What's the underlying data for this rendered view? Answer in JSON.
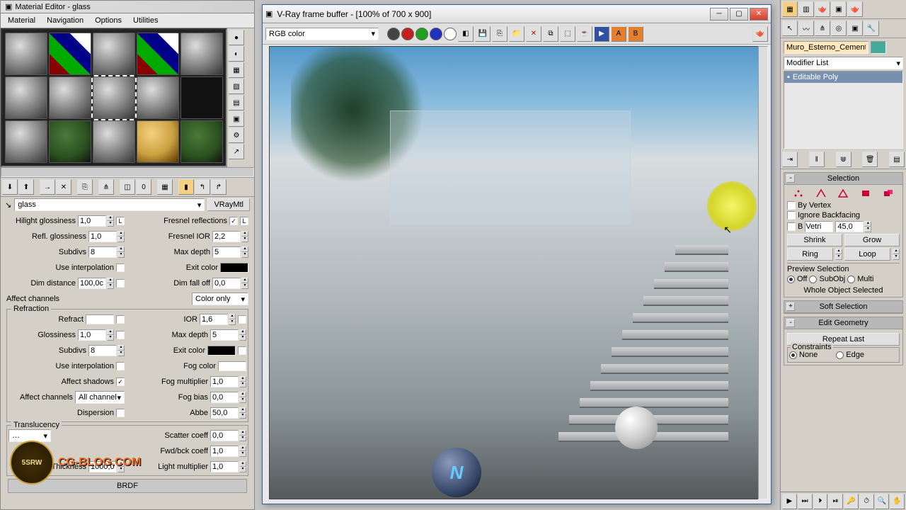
{
  "matEditor": {
    "title": "Material Editor - glass",
    "menu": [
      "Material",
      "Navigation",
      "Options",
      "Utilities"
    ],
    "nameDropdown": "glass",
    "matType": "VRayMtl",
    "hilightGloss": {
      "label": "Hilight glossiness",
      "val": "1,0"
    },
    "fresnelRefl": {
      "label": "Fresnel reflections",
      "checked": true
    },
    "reflGloss": {
      "label": "Refl. glossiness",
      "val": "1,0"
    },
    "fresnelIOR": {
      "label": "Fresnel IOR",
      "val": "2,2"
    },
    "subdivs": {
      "label": "Subdivs",
      "val": "8"
    },
    "maxDepth": {
      "label": "Max depth",
      "val": "5"
    },
    "useInterp": {
      "label": "Use interpolation"
    },
    "exitColor": {
      "label": "Exit color"
    },
    "dimDist": {
      "label": "Dim distance",
      "val": "100,0c"
    },
    "dimFalloff": {
      "label": "Dim fall off",
      "val": "0,0"
    },
    "affectCh": {
      "label": "Affect channels",
      "val": "Color only"
    },
    "refraction": {
      "title": "Refraction",
      "refract": {
        "label": "Refract"
      },
      "ior": {
        "label": "IOR",
        "val": "1,6"
      },
      "gloss": {
        "label": "Glossiness",
        "val": "1,0"
      },
      "maxDepth": {
        "label": "Max depth",
        "val": "5"
      },
      "subdivs": {
        "label": "Subdivs",
        "val": "8"
      },
      "exitColor": {
        "label": "Exit color"
      },
      "useInterp": {
        "label": "Use interpolation"
      },
      "fogColor": {
        "label": "Fog color"
      },
      "affectShadows": {
        "label": "Affect shadows",
        "checked": true
      },
      "fogMult": {
        "label": "Fog multiplier",
        "val": "1,0"
      },
      "affectCh": {
        "label": "Affect channels",
        "val": "All channel"
      },
      "fogBias": {
        "label": "Fog bias",
        "val": "0,0"
      },
      "dispersion": {
        "label": "Dispersion"
      },
      "abbe": {
        "label": "Abbe",
        "val": "50,0"
      }
    },
    "trans": {
      "title": "Translucency",
      "scatter": {
        "label": "Scatter coeff",
        "val": "0,0"
      },
      "fwdback": {
        "label": "Fwd/bck coeff",
        "val": "1,0"
      },
      "thickness": {
        "label": "Thickness",
        "val": "1000,0"
      },
      "lightMult": {
        "label": "Light multiplier",
        "val": "1,0"
      }
    },
    "brdf": "BRDF"
  },
  "vfb": {
    "title": "V-Ray frame buffer - [100% of 700 x 900]",
    "channel": "RGB color"
  },
  "badge": {
    "cert": "5SRW",
    "blog": "CG-BLOG.COM"
  },
  "right": {
    "objName": "Muro_Esterno_Cemento",
    "modList": "Modifier List",
    "editPoly": "Editable Poly",
    "selection": {
      "title": "Selection",
      "byVertex": "By Vertex",
      "ignoreBack": "Ignore Backfacing",
      "byLabel": "B",
      "byField": "Vetri",
      "byAngle": "45,0",
      "shrink": "Shrink",
      "grow": "Grow",
      "ring": "Ring",
      "loop": "Loop",
      "preview": "Preview Selection",
      "off": "Off",
      "subobj": "SubObj",
      "multi": "Multi",
      "whole": "Whole Object Selected"
    },
    "softSel": "Soft Selection",
    "editGeom": "Edit Geometry",
    "repeat": "Repeat Last",
    "constraints": {
      "title": "Constraints",
      "none": "None",
      "edge": "Edge"
    }
  }
}
